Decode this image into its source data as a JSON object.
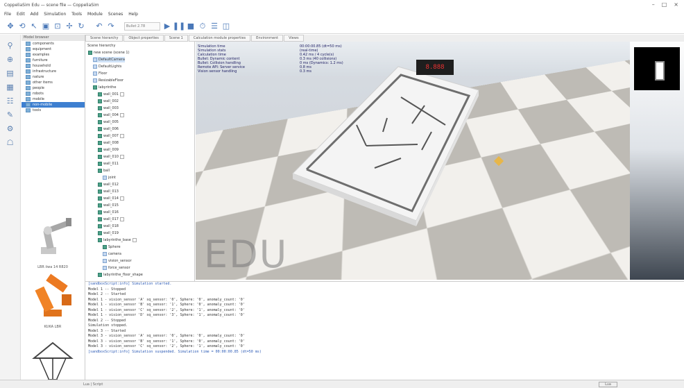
{
  "window": {
    "title": "CoppeliaSim Edu — scene file — CoppeliaSim",
    "controls": [
      "–",
      "□",
      "×"
    ]
  },
  "menu": [
    "File",
    "Edit",
    "Add",
    "Simulation",
    "Tools",
    "Module",
    "Scenes",
    "Help"
  ],
  "toolbar": {
    "icons": [
      "move-icon",
      "rotate-icon",
      "select-icon",
      "camera-icon",
      "fit-icon",
      "object-move-icon",
      "object-rotate-icon",
      "undo-icon",
      "redo-icon",
      "play-icon",
      "pause-icon",
      "stop-icon",
      "realtime-icon",
      "layers-icon",
      "scene-icon"
    ],
    "engine_select": "Bullet 2.78"
  },
  "left_tools": [
    "magnifier-icon",
    "zoom-icon",
    "scene-icon",
    "grid-icon",
    "layers-icon",
    "script-icon",
    "settings-icon",
    "robot-icon"
  ],
  "model_browser": {
    "header": "Model browser",
    "items": [
      "components",
      "equipment",
      "examples",
      "furniture",
      "household",
      "infrastructure",
      "nature",
      "other items",
      "people",
      "robots",
      "mobile",
      "non-mobile",
      "tools"
    ],
    "selected_index": 11,
    "thumbnails": [
      {
        "name": "robot-arm-thumb",
        "caption": "LBR iiwa 14 R820"
      },
      {
        "name": "orange-robot-thumb",
        "caption": "KUKA LBR"
      },
      {
        "name": "delta-robot-thumb",
        "caption": ""
      }
    ]
  },
  "tabs": [
    "Scene hierarchy",
    "Object properties",
    "Scene 1",
    "Calculation module properties",
    "Environment",
    "Views"
  ],
  "scene_tree": {
    "title": "Scene hierarchy",
    "rows": [
      {
        "label": "new scene (scene 1)",
        "indent": 0,
        "type": "scene"
      },
      {
        "label": "DefaultCamera",
        "indent": 1,
        "type": "obj"
      },
      {
        "label": "DefaultLights",
        "indent": 1,
        "type": "obj"
      },
      {
        "label": "Floor",
        "indent": 1,
        "type": "obj"
      },
      {
        "label": "ResizableFloor",
        "indent": 1,
        "type": "obj"
      },
      {
        "label": "labyrinthe",
        "indent": 1,
        "type": "shape"
      },
      {
        "label": "wall_001",
        "indent": 2,
        "type": "shape"
      },
      {
        "label": "wall_002",
        "indent": 2,
        "type": "shape"
      },
      {
        "label": "wall_003",
        "indent": 2,
        "type": "shape"
      },
      {
        "label": "wall_004",
        "indent": 2,
        "type": "shape"
      },
      {
        "label": "wall_005",
        "indent": 2,
        "type": "shape"
      },
      {
        "label": "wall_006",
        "indent": 2,
        "type": "shape"
      },
      {
        "label": "wall_007",
        "indent": 2,
        "type": "shape"
      },
      {
        "label": "wall_008",
        "indent": 2,
        "type": "shape"
      },
      {
        "label": "wall_009",
        "indent": 2,
        "type": "shape"
      },
      {
        "label": "wall_010",
        "indent": 2,
        "type": "shape"
      },
      {
        "label": "wall_011",
        "indent": 2,
        "type": "shape"
      },
      {
        "label": "ball",
        "indent": 2,
        "type": "shape"
      },
      {
        "label": "joint",
        "indent": 3,
        "type": "obj"
      },
      {
        "label": "wall_012",
        "indent": 2,
        "type": "shape"
      },
      {
        "label": "wall_013",
        "indent": 2,
        "type": "shape"
      },
      {
        "label": "wall_014",
        "indent": 2,
        "type": "shape"
      },
      {
        "label": "wall_015",
        "indent": 2,
        "type": "shape"
      },
      {
        "label": "wall_016",
        "indent": 2,
        "type": "shape"
      },
      {
        "label": "wall_017",
        "indent": 2,
        "type": "shape"
      },
      {
        "label": "wall_018",
        "indent": 2,
        "type": "shape"
      },
      {
        "label": "wall_019",
        "indent": 2,
        "type": "shape"
      },
      {
        "label": "labyrinthe_base",
        "indent": 2,
        "type": "shape"
      },
      {
        "label": "Sphere",
        "indent": 3,
        "type": "shape"
      },
      {
        "label": "camera",
        "indent": 3,
        "type": "obj"
      },
      {
        "label": "vision_sensor",
        "indent": 3,
        "type": "obj"
      },
      {
        "label": "force_sensor",
        "indent": 3,
        "type": "obj"
      },
      {
        "label": "labyrinthe_floor_shape",
        "indent": 2,
        "type": "shape"
      }
    ],
    "selected_index": 1
  },
  "viewport": {
    "overlay_labels": [
      "Simulation time",
      "Simulation stats",
      "Calculation time",
      "Bullet: Dynamic content",
      "Bullet: Collision handling",
      "Remote API: Server service",
      "Vision sensor handling"
    ],
    "overlay_values": [
      "00:00:00.85 (dt=50 ms)",
      "(real-time)",
      "0.42 ms / 4 cycle(s)",
      "0.3 ms (40 collisions)",
      "0 ms (Dynamics: 1.2 ms)",
      "0.8 ms",
      "0.3 ms"
    ],
    "readout": "8.888",
    "watermark": "EDU"
  },
  "console": {
    "lines": [
      "[sandboxScript:info]  Simulation started.",
      "Model 1 -- Stopped",
      "Model 2 -- Started",
      "  Model 1 - vision_sensor 'A' sq_sensor: '0', Sphere: '0', anomaly_count: '0'",
      "  Model 1 - vision_sensor 'B' sq_sensor: '1', Sphere: '0', anomaly_count: '0'",
      "  Model 1 - vision_sensor 'C' sq_sensor: '2', Sphere: '1', anomaly_count: '0'",
      "  Model 1 - vision_sensor 'D' sq_sensor: '3', Sphere: '1', anomaly_count: '0'",
      "Model 2 -- Stopped",
      "Simulation stopped.",
      "Model 3 -- Started",
      "  Model 3 - vision_sensor 'A' sq_sensor: '0', Sphere: '0', anomaly_count: '0'",
      "  Model 3 - vision_sensor 'B' sq_sensor: '1', Sphere: '0', anomaly_count: '0'",
      "  Model 3 - vision_sensor 'C' sq_sensor: '2', Sphere: '1', anomaly_count: '0'",
      "[sandboxScript:info]  Simulation suspended. Simulation time = 00:00:00.85 (dt=50 ms)"
    ]
  },
  "status": {
    "left": "Lua  |  Script",
    "right": "Lua"
  }
}
